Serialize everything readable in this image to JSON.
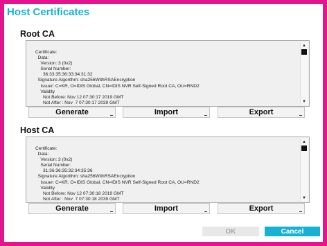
{
  "dialog": {
    "title": "Host Certificates",
    "ok_label": "OK",
    "cancel_label": "Cancel"
  },
  "root_ca": {
    "title": "Root CA",
    "certificate_text": "Certificate:\n  Data:\n    Version: 3 (0x2)\n    Serial Number:\n      36:33:35:36:33:34:31:32\n  Signature Algorithm: sha256WithRSAEncryption\n    Issuer: C=KR, O=IDIS Global, CN=IDIS NVR Self-Signed Root CA, OU=RND2\n    Validity\n      Not Before: Nov 12 07:30:17 2019 GMT\n      Not After : Nov  7 07:30:17 2039 GMT",
    "buttons": {
      "generate": "Generate",
      "import": "Import",
      "export": "Export"
    }
  },
  "host_ca": {
    "title": "Host CA",
    "certificate_text": "Certificate:\n  Data:\n    Version: 3 (0x2)\n    Serial Number:\n      31:36:36:35:32:34:35:36\n  Signature Algorithm: sha256WithRSAEncryption\n    Issuer: C=KR, O=IDIS Global, CN=IDIS NVR Self-Signed Root CA, OU=RND2\n    Validity\n      Not Before: Nov 12 07:30:18 2019 GMT\n      Not After : Nov  7 07:30:18 2039 GMT",
    "buttons": {
      "generate": "Generate",
      "import": "Import",
      "export": "Export"
    }
  },
  "colors": {
    "frame": "#e3148e",
    "accent": "#17b1d4",
    "disabled_button": "#e8e8e8"
  },
  "icons": {
    "scroll_up": "▲",
    "scroll_down": "▼"
  }
}
